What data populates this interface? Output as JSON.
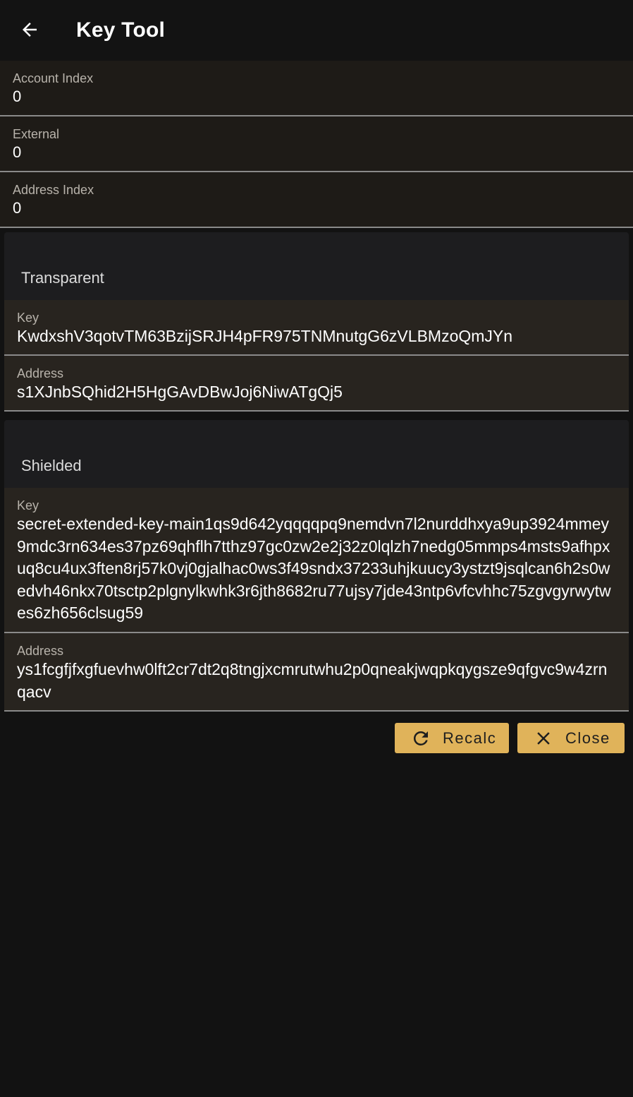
{
  "appbar": {
    "title": "Key Tool"
  },
  "fields": {
    "account_index": {
      "label": "Account Index",
      "value": "0"
    },
    "external": {
      "label": "External",
      "value": "0"
    },
    "address_index": {
      "label": "Address Index",
      "value": "0"
    }
  },
  "transparent": {
    "title": "Transparent",
    "key_label": "Key",
    "key_value": "KwdxshV3qotvTM63BzijSRJH4pFR975TNMnutgG6zVLBMzoQmJYn",
    "address_label": "Address",
    "address_value": "s1XJnbSQhid2H5HgGAvDBwJoj6NiwATgQj5"
  },
  "shielded": {
    "title": "Shielded",
    "key_label": "Key",
    "key_value": "secret-extended-key-main1qs9d642yqqqqpq9nemdvn7l2nurddhxya9up3924mmey9mdc3rn634es37pz69qhflh7tthz97gc0zw2e2j32z0lqlzh7nedg05mmps4msts9afhpxuq8cu4ux3ften8rj57k0vj0gjalhac0ws3f49sndx37233uhjkuucy3ystzt9jsqlcan6h2s0wedvh46nkx70tsctp2plgnylkwhk3r6jth8682ru77ujsy7jde43ntp6vfcvhhc75zgvgyrwytwes6zh656clsug59",
    "address_label": "Address",
    "address_value": "ys1fcgfjfxgfuevhw0lft2cr7dt2q8tngjxcmrutwhu2p0qneakjwqpkqygsze9qfgvc9w4zrnqacv"
  },
  "actions": {
    "recalc_label": "Recalc",
    "close_label": "Close"
  },
  "colors": {
    "accent": "#e0b35a",
    "background": "#121212",
    "field_bg": "#1e1b17"
  }
}
